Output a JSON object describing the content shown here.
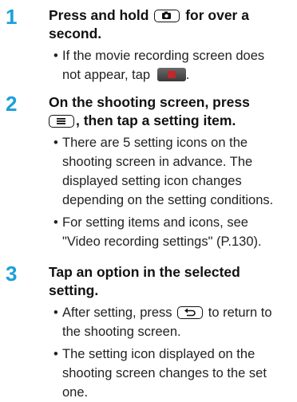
{
  "steps": [
    {
      "number": "1",
      "heading_a": "Press and hold",
      "heading_b": "for over a",
      "heading_c": "second.",
      "bullets": [
        {
          "line1": "If the movie recording screen does",
          "line2": "not appear, tap"
        }
      ],
      "icons": [
        "camera-key-icon",
        "movie-mode-tab-icon"
      ]
    },
    {
      "number": "2",
      "heading_a": "On the shooting screen, press",
      "heading_b": ", then tap a setting item.",
      "bullets": [
        {
          "lines": [
            "There are 5 setting icons on the",
            "shooting screen in advance. The",
            "displayed setting icon changes",
            "depending on the setting conditions."
          ]
        },
        {
          "lines": [
            "For setting items and icons, see",
            "\"Video recording settings\" (P.130)."
          ]
        }
      ],
      "icons": [
        "menu-key-icon"
      ]
    },
    {
      "number": "3",
      "heading_a": "Tap an option in the selected",
      "heading_b": "setting.",
      "bullets": [
        {
          "line1a": "After setting, press",
          "line1b": "to return to",
          "line2": "the shooting screen."
        },
        {
          "lines": [
            "The setting icon displayed on the",
            "shooting screen changes to the set",
            "one."
          ]
        }
      ],
      "icons": [
        "back-key-icon"
      ]
    }
  ]
}
